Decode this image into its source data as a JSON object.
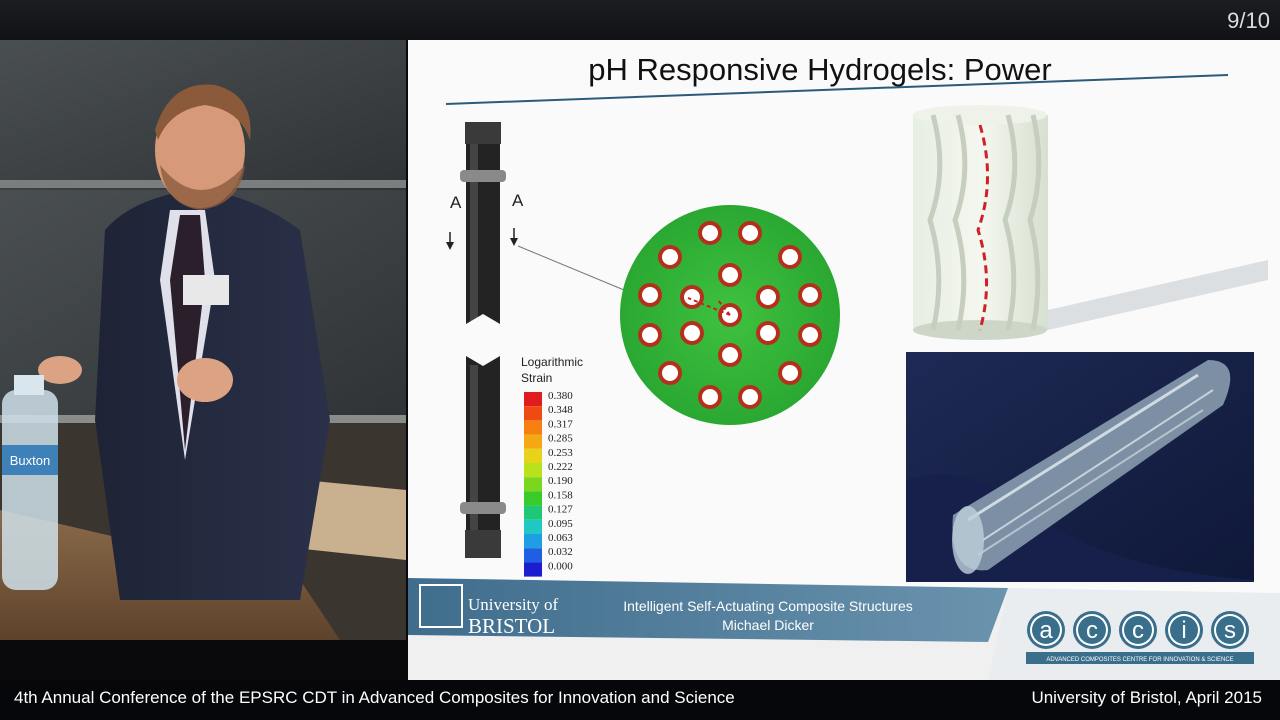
{
  "slide_counter": "9/10",
  "slide": {
    "title": "pH Responsive Hydrogels: Power",
    "section_marker": "A",
    "legend": {
      "title_line1": "Logarithmic",
      "title_line2": "Strain",
      "values": [
        "0.380",
        "0.348",
        "0.317",
        "0.285",
        "0.253",
        "0.222",
        "0.190",
        "0.158",
        "0.127",
        "0.095",
        "0.063",
        "0.032",
        "0.000"
      ],
      "colors": [
        "#e01d1d",
        "#f04a14",
        "#f57f10",
        "#f4a913",
        "#e8d21a",
        "#b8e21c",
        "#7ad71e",
        "#39cb2a",
        "#1ec877",
        "#1fc8c4",
        "#1f9ee3",
        "#1e5fe3",
        "#1a1ed0"
      ]
    },
    "footer": {
      "university_line1": "University of",
      "university_line2": "BRISTOL",
      "project_title": "Intelligent Self-Actuating Composite Structures",
      "author": "Michael Dicker",
      "logo_letters": [
        "a",
        "c",
        "c",
        "i",
        "s"
      ],
      "logo_tagline": "ADVANCED COMPOSITES CENTRE FOR INNOVATION & SCIENCE"
    }
  },
  "caption": {
    "left": "4th Annual Conference of the EPSRC CDT in Advanced Composites for Innovation and Science",
    "right": "University of Bristol, April 2015"
  },
  "speaker": {
    "bottle_label": "Buxton"
  },
  "colors": {
    "slide_blue": "#4f7d99",
    "mesh_green": "#36b53c",
    "hole_red": "#b5301c"
  }
}
